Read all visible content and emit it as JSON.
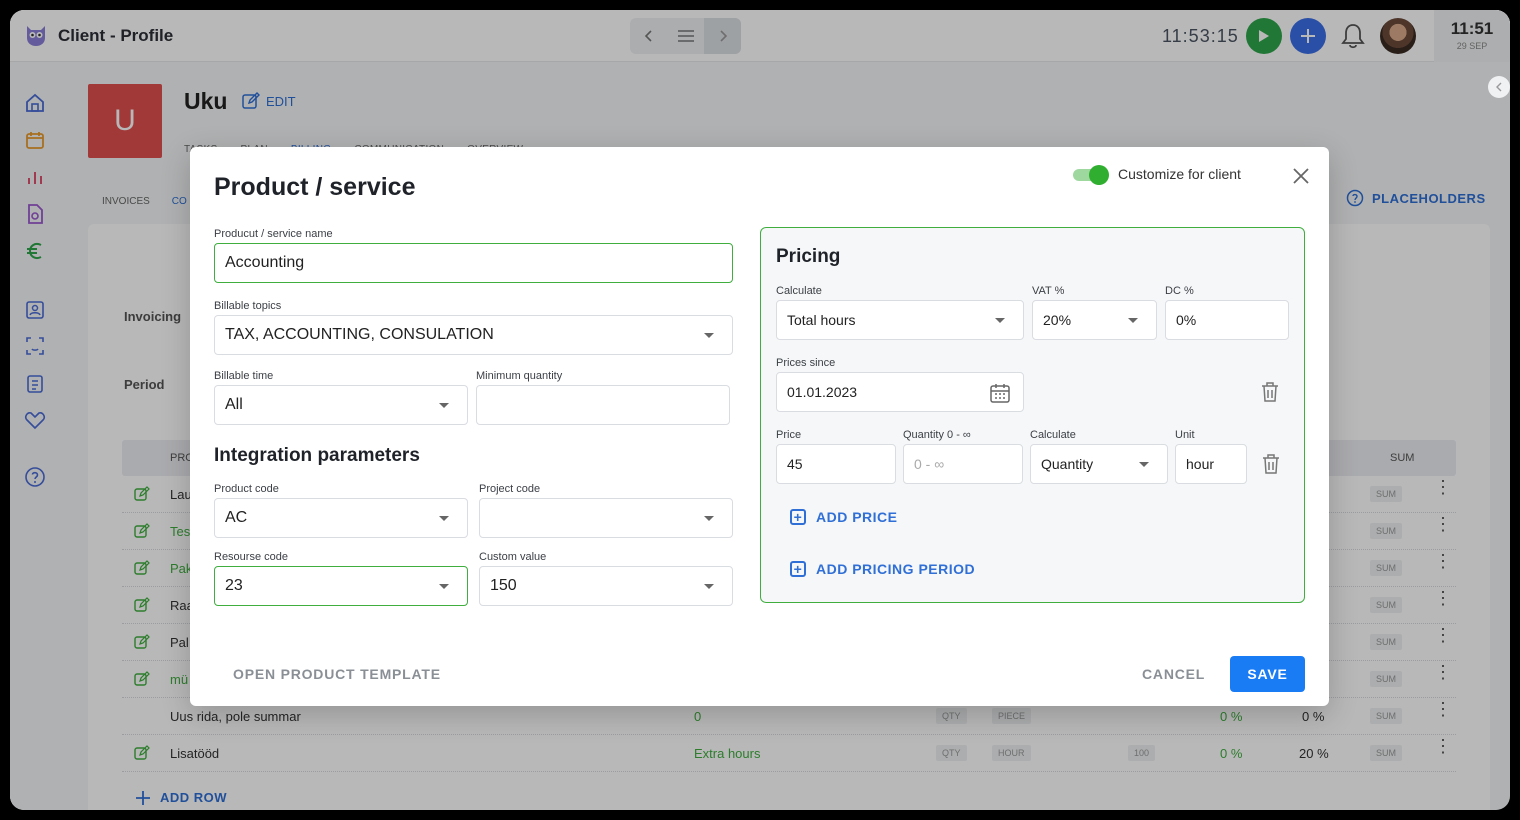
{
  "window": {
    "title": "Client - Profile",
    "clock": "11:53:15",
    "system_time": "11:51",
    "system_date": "29 SEP"
  },
  "client": {
    "initial": "U",
    "name": "Uku",
    "edit_label": "EDIT"
  },
  "tabs": [
    "TASKS",
    "PLAN",
    "BILLING",
    "COMMUNICATION",
    "OVERVIEW"
  ],
  "subtabs": [
    "INVOICES",
    "CO"
  ],
  "placeholders_label": "PLACEHOLDERS",
  "background": {
    "invoicing_label": "Invoicing",
    "period_label": "Period",
    "table_head": {
      "product": "PRO",
      "sum": "SUM"
    },
    "rows": [
      {
        "name": "Lau",
        "sum": "SUM"
      },
      {
        "name": "Tes",
        "sum": "SUM"
      },
      {
        "name": "Pak",
        "sum": "SUM"
      },
      {
        "name": "Raa",
        "sum": "SUM"
      },
      {
        "name": "Pal",
        "sum": "SUM"
      },
      {
        "name": "mü",
        "sum": "SUM"
      },
      {
        "name": "Uus rida, pole summar",
        "qty": "0",
        "unit_type": "QTY",
        "unit": "PIECE",
        "dc": "0 %",
        "vat": "0 %",
        "sum": "SUM"
      },
      {
        "name": "Lisatööd",
        "qty": "Extra hours",
        "unit_type": "QTY",
        "unit": "HOUR",
        "price": "100",
        "dc": "0 %",
        "vat": "20 %",
        "sum": "SUM"
      }
    ],
    "add_row_label": "ADD ROW"
  },
  "modal": {
    "title": "Product / service",
    "customize_label": "Customize for client",
    "customize_on": true,
    "product_name": {
      "label": "Producut / service name",
      "value": "Accounting"
    },
    "billable_topics": {
      "label": "Billable topics",
      "value": "TAX, ACCOUNTING, CONSULATION"
    },
    "billable_time": {
      "label": "Billable time",
      "value": "All"
    },
    "minimum_quantity": {
      "label": "Minimum quantity",
      "value": ""
    },
    "integration_title": "Integration parameters",
    "product_code": {
      "label": "Product code",
      "value": "AC"
    },
    "project_code": {
      "label": "Project code",
      "value": ""
    },
    "resource_code": {
      "label": "Resourse code",
      "value": "23"
    },
    "custom_value": {
      "label": "Custom value",
      "value": "150"
    },
    "pricing": {
      "title": "Pricing",
      "calculate": {
        "label": "Calculate",
        "value": "Total hours"
      },
      "vat": {
        "label": "VAT %",
        "value": "20%"
      },
      "dc": {
        "label": "DC %",
        "value": "0%"
      },
      "prices_since": {
        "label": "Prices since",
        "value": "01.01.2023"
      },
      "price": {
        "label": "Price",
        "value": "45"
      },
      "quantity": {
        "label": "Quantity 0 - ∞",
        "placeholder": "0 - ∞"
      },
      "row_calculate": {
        "label": "Calculate",
        "value": "Quantity"
      },
      "unit": {
        "label": "Unit",
        "value": "hour"
      },
      "add_price_label": "ADD PRICE",
      "add_period_label": "ADD PRICING PERIOD"
    },
    "open_template_label": "OPEN PRODUCT TEMPLATE",
    "cancel_label": "CANCEL",
    "save_label": "SAVE"
  },
  "colors": {
    "accent": "#1a7cf5",
    "link": "#2f6fd6",
    "success": "#2fae2f",
    "client_avatar": "#e05050"
  }
}
